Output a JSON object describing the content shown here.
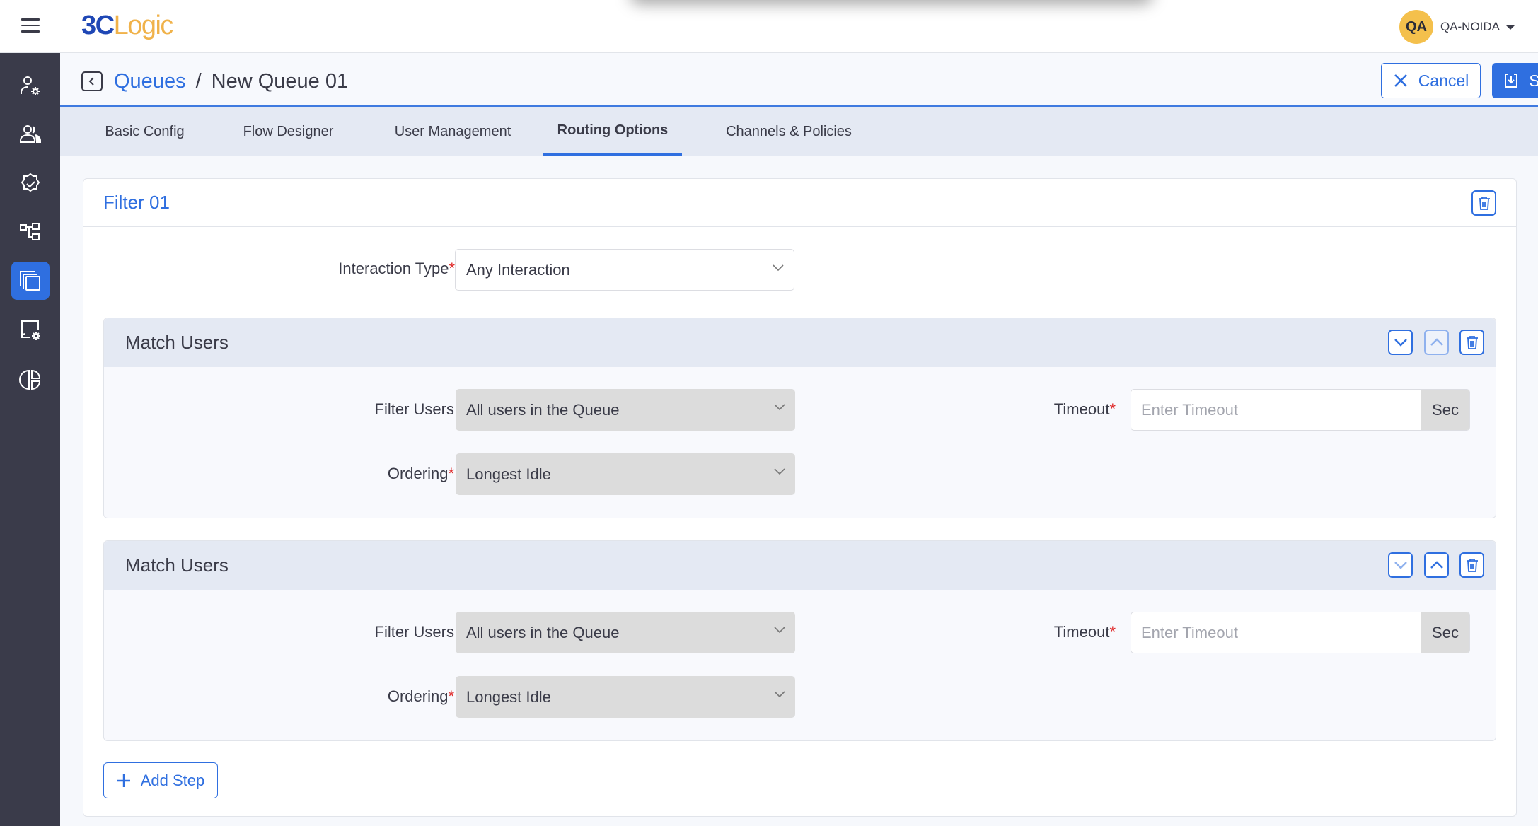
{
  "header": {
    "logo_part1": "3C",
    "logo_part2": "Logic",
    "user_initials": "QA",
    "user_name": "QA-NOIDA"
  },
  "sidebar": {
    "items": [
      {
        "icon": "user-settings-icon",
        "active": false
      },
      {
        "icon": "users-group-icon",
        "active": false
      },
      {
        "icon": "verified-badge-icon",
        "active": false
      },
      {
        "icon": "hierarchy-icon",
        "active": false
      },
      {
        "icon": "queues-stack-icon",
        "active": true
      },
      {
        "icon": "screen-settings-icon",
        "active": false
      },
      {
        "icon": "analytics-pie-icon",
        "active": false
      }
    ]
  },
  "breadcrumb": {
    "parent": "Queues",
    "separator": "/",
    "current": "New Queue 01"
  },
  "actions": {
    "cancel": "Cancel",
    "save": "Save"
  },
  "tabs": [
    {
      "label": "Basic Config",
      "active": false
    },
    {
      "label": "Flow Designer",
      "active": false
    },
    {
      "label": "User Management",
      "active": false
    },
    {
      "label": "Routing Options",
      "active": true
    },
    {
      "label": "Channels & Policies",
      "active": false
    }
  ],
  "filter": {
    "title": "Filter 01",
    "interaction_type_label": "Interaction Type",
    "interaction_type_value": "Any Interaction",
    "required_mark": "*"
  },
  "steps": [
    {
      "title": "Match Users",
      "filter_users_label": "Filter Users",
      "filter_users_value": "All users in the Queue",
      "ordering_label": "Ordering",
      "ordering_value": "Longest Idle",
      "timeout_label": "Timeout",
      "timeout_placeholder": "Enter Timeout",
      "timeout_value": "",
      "timeout_unit": "Sec",
      "move_down_enabled": true,
      "move_up_enabled": false
    },
    {
      "title": "Match Users",
      "filter_users_label": "Filter Users",
      "filter_users_value": "All users in the Queue",
      "ordering_label": "Ordering",
      "ordering_value": "Longest Idle",
      "timeout_label": "Timeout",
      "timeout_placeholder": "Enter Timeout",
      "timeout_value": "",
      "timeout_unit": "Sec",
      "move_down_enabled": false,
      "move_up_enabled": true
    }
  ],
  "add_step": "Add Step",
  "colors": {
    "accent": "#2f6fe0",
    "sidebar": "#3a3b4a",
    "avatar": "#f4c04c",
    "required": "#e02b2b"
  }
}
